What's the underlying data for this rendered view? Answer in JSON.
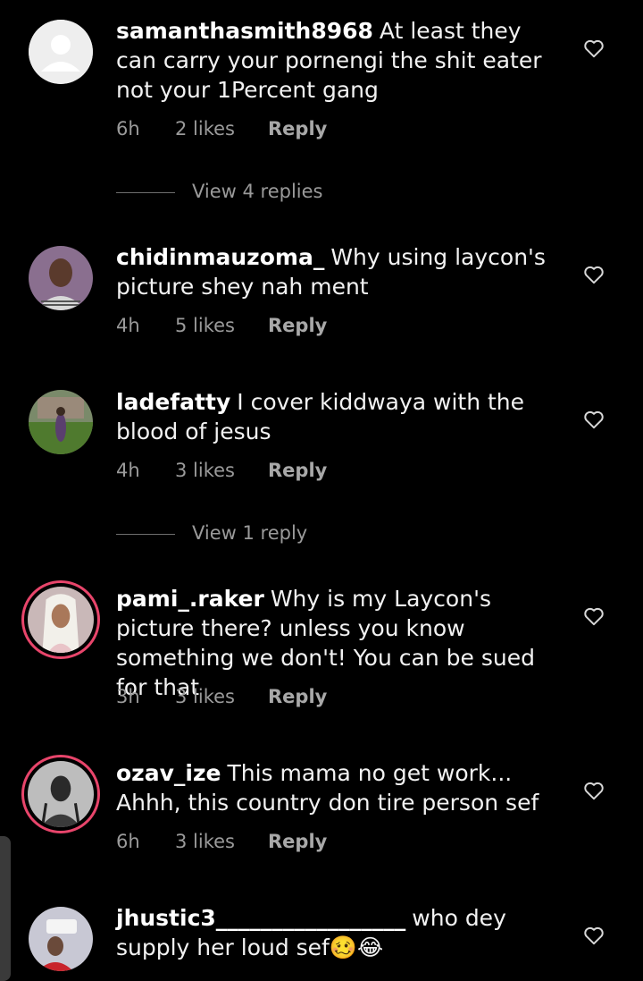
{
  "comments": [
    {
      "username": "samanthasmith8968",
      "text": "At least they can carry your pornengi the shit eater not your 1Percent gang",
      "time": "6h",
      "likes": "2 likes",
      "reply": "Reply",
      "avatar": "default-avatar"
    },
    {
      "username": "chidinmauzoma_",
      "text": "Why using laycon's picture shey nah ment",
      "time": "4h",
      "likes": "5 likes",
      "reply": "Reply",
      "avatar": "photo-avatar"
    },
    {
      "username": "ladefatty",
      "text": "I cover kiddwaya with the blood of jesus",
      "time": "4h",
      "likes": "3 likes",
      "reply": "Reply",
      "avatar": "photo-avatar"
    },
    {
      "username": "pami_.raker",
      "text": "Why is my Laycon's picture there? unless you know something we don't! You can be sued for that",
      "time": "3h",
      "likes": "3 likes",
      "reply": "Reply",
      "avatar": "story-ring-avatar"
    },
    {
      "username": "ozav_ize",
      "text": "This mama no get work... Ahhh, this country don tire person sef",
      "time": "6h",
      "likes": "3 likes",
      "reply": "Reply",
      "avatar": "story-ring-avatar"
    },
    {
      "username": "jhustic3_________________",
      "text": "who dey supply her loud sef🥴😂",
      "avatar": "photo-avatar"
    }
  ],
  "view_replies": [
    {
      "label": "View 4 replies"
    },
    {
      "label": "View 1 reply"
    }
  ],
  "icons": {
    "like": "heart-outline-icon"
  },
  "colors": {
    "background": "#000000",
    "story_ring": "#e8456b",
    "meta": "#9a9a9a"
  }
}
